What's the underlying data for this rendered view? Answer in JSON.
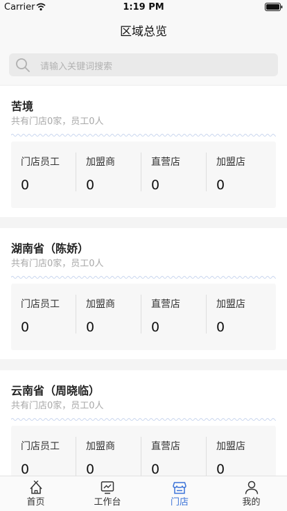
{
  "status_bar": {
    "carrier": "Carrier",
    "time": "1:19 PM"
  },
  "nav": {
    "title": "区域总览"
  },
  "search": {
    "placeholder": "请输入关键词搜索"
  },
  "regions": [
    {
      "name": "苦境",
      "summary": "共有门店0家，员工0人",
      "stats": [
        {
          "label": "门店员工",
          "value": "0"
        },
        {
          "label": "加盟商",
          "value": "0"
        },
        {
          "label": "直营店",
          "value": "0"
        },
        {
          "label": "加盟店",
          "value": "0"
        }
      ]
    },
    {
      "name": "湖南省（陈娇）",
      "summary": "共有门店0家，员工0人",
      "stats": [
        {
          "label": "门店员工",
          "value": "0"
        },
        {
          "label": "加盟商",
          "value": "0"
        },
        {
          "label": "直营店",
          "value": "0"
        },
        {
          "label": "加盟店",
          "value": "0"
        }
      ]
    },
    {
      "name": "云南省（周晓临）",
      "summary": "共有门店0家，员工0人",
      "stats": [
        {
          "label": "门店员工",
          "value": "0"
        },
        {
          "label": "加盟商",
          "value": "0"
        },
        {
          "label": "直营店",
          "value": "0"
        },
        {
          "label": "加盟店",
          "value": "0"
        }
      ]
    }
  ],
  "tabbar": {
    "accent_color": "#3b73d8",
    "active_index": 2,
    "items": [
      {
        "label": "首页",
        "icon": "home-icon"
      },
      {
        "label": "工作台",
        "icon": "workbench-icon"
      },
      {
        "label": "门店",
        "icon": "store-icon"
      },
      {
        "label": "我的",
        "icon": "profile-icon"
      }
    ]
  }
}
